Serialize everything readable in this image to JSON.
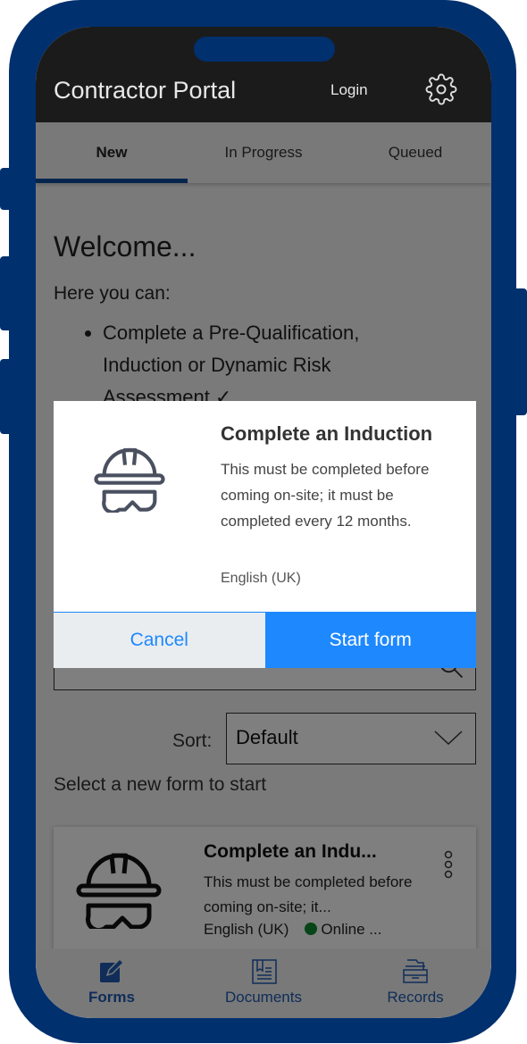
{
  "header": {
    "title": "Contractor Portal",
    "login": "Login",
    "settings_icon": "gear-icon"
  },
  "tabs": [
    {
      "label": "New",
      "active": true
    },
    {
      "label": "In Progress"
    },
    {
      "label": "Queued"
    }
  ],
  "main": {
    "welcome": "Welcome...",
    "here": "Here you can:",
    "bullets": [
      "Complete a Pre-Qualification, Induction or Dynamic Risk Assessment ✓"
    ],
    "sort_label": "Sort:",
    "sort_value": "Default",
    "hint": "Select a new form to start"
  },
  "card": {
    "title": "Complete an Indu...",
    "desc": "This must be completed before coming on-site; it...",
    "language": "English (UK)",
    "status": "Online ...",
    "status_color": "#0c8a2e"
  },
  "nav": [
    {
      "label": "Forms",
      "icon": "edit-icon",
      "active": true
    },
    {
      "label": "Documents",
      "icon": "document-icon"
    },
    {
      "label": "Records",
      "icon": "archive-icon"
    }
  ],
  "modal": {
    "title": "Complete an Induction",
    "desc": "This must be completed before coming on-site; it must be completed every 12 months.",
    "language": "English (UK)",
    "cancel": "Cancel",
    "start": "Start form",
    "accent": "#1e88ff"
  }
}
